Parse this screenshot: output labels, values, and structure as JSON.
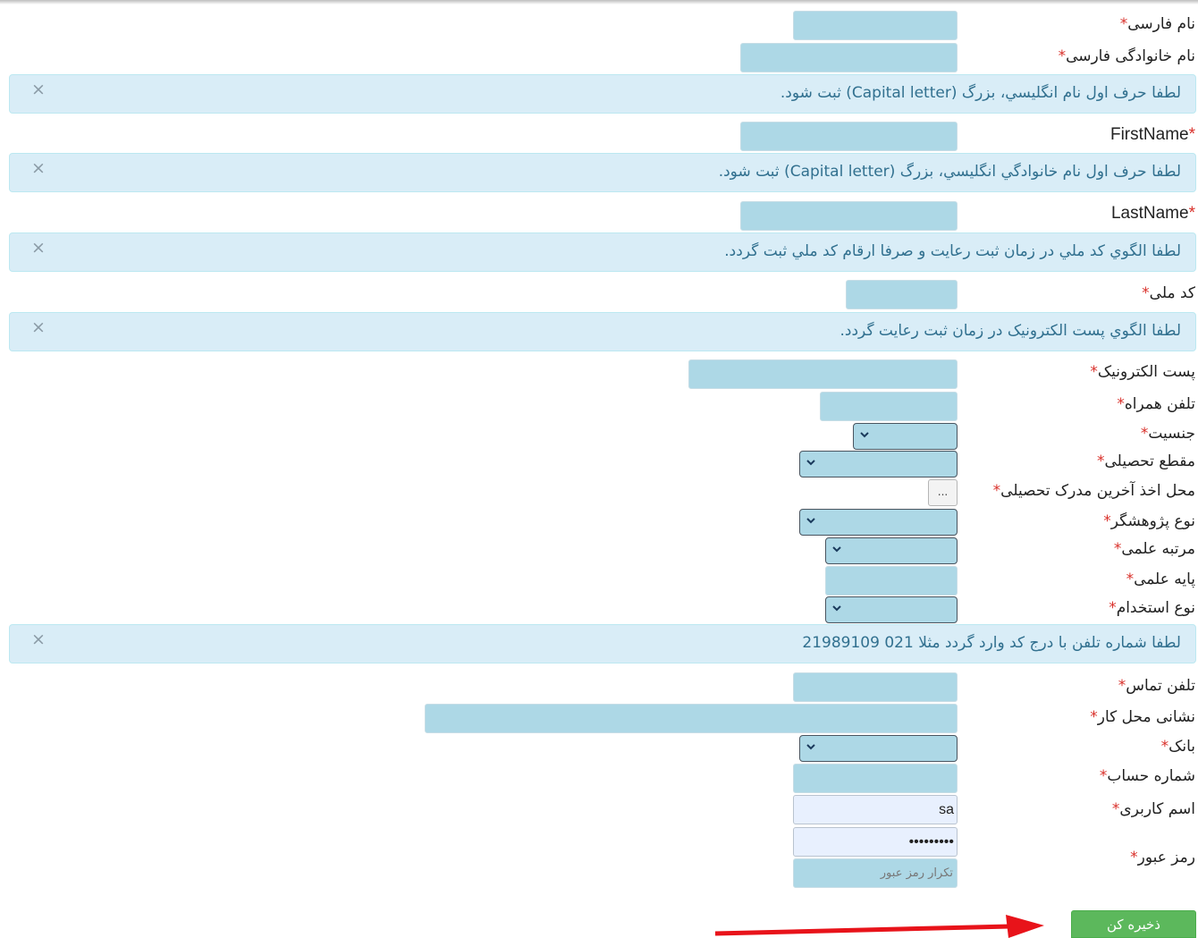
{
  "form": {
    "required_mark": "*",
    "first_name_fa": "نام فارسی",
    "last_name_fa": "نام خانوادگی فارسی",
    "hint_first_name": "لطفا حرف اول نام انگليسي، بزرگ (Capital letter) ثبت شود.",
    "first_name_en": "FirstName",
    "hint_last_name": "لطفا حرف اول نام خانوادگي انگليسي، بزرگ (Capital letter) ثبت شود.",
    "last_name_en": "LastName",
    "hint_national_code": "لطفا الگوي کد ملي در زمان ثبت رعايت و صرفا ارقام کد ملي ثبت گردد.",
    "national_code": "کد ملی",
    "hint_email": "لطفا الگوي پست الکترونيک در زمان ثبت رعايت گردد.",
    "email": "پست الکترونیک",
    "mobile": "تلفن همراه",
    "gender": "جنسیت",
    "education_level": "مقطع تحصیلی",
    "degree_place": "محل اخذ آخرین مدرک تحصیلی",
    "degree_place_button": "...",
    "researcher_type": "نوع پژوهشگر",
    "academic_rank": "مرتبه علمی",
    "academic_grade": "پایه علمی",
    "employment_type": "نوع استخدام",
    "hint_phone": "لطفا شماره تلفن با درج کد وارد گردد مثلا 021 21989109",
    "phone": "تلفن تماس",
    "work_address": "نشانی محل کار",
    "bank": "بانک",
    "account_number": "شماره حساب",
    "username": "اسم کاربری",
    "username_value": "sa",
    "password": "رمز عبور",
    "password_value": "•••••••••",
    "password_repeat_placeholder": "تکرار رمز عبور",
    "close_symbol": "×",
    "save_button": "ذخیره کن"
  },
  "colors": {
    "input_bg": "#add8e6",
    "alert_bg": "#d9edf7",
    "alert_text": "#31708f",
    "required": "#d9302a",
    "save_bg": "#5cb85c",
    "arrow": "#e8131a"
  }
}
